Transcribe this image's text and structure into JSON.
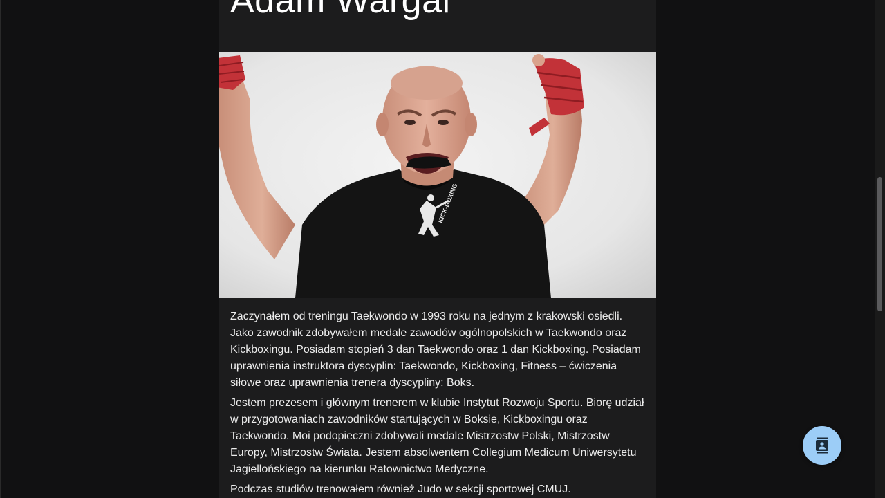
{
  "profile": {
    "name": "Adam Wargal",
    "photo_alt": "Adam Wargal"
  },
  "bio": {
    "paragraphs": [
      "Zaczynałem od treningu Taekwondo w 1993 roku na jednym z krakowski osiedli. Jako zawodnik zdobywałem medale zawodów ogólnopolskich w Taekwondo oraz Kickboxingu. Posiadam stopień 3 dan Taekwondo oraz 1 dan Kickboxing. Posiadam uprawnienia instruktora dyscyplin: Taekwondo, Kickboxing, Fitness – ćwiczenia siłowe oraz uprawnienia trenera dyscypliny: Boks.",
      "Jestem prezesem i głównym trenerem w klubie Instytut Rozwoju Sportu. Biorę udział w przygotowaniach zawodników startujących w Boksie, Kickboxingu oraz Taekwondo. Moi podopieczni zdobywali medale Mistrzostw Polski, Mistrzostw Europy, Mistrzostw Świata. Jestem absolwentem Collegium Medicum Uniwersytetu Jagiellońskiego na kierunku Ratownictwo Medyczne.",
      "Podczas studiów trenowałem również Judo w sekcji sportowej CMUJ."
    ]
  },
  "shirt_print": "KICK-BOXING",
  "fab": {
    "icon": "contact-card-icon"
  },
  "colors": {
    "page_bg": "#111112",
    "card_bg": "#1c1c1d",
    "fab_bg": "#9ccdf7",
    "text": "#ececec"
  }
}
